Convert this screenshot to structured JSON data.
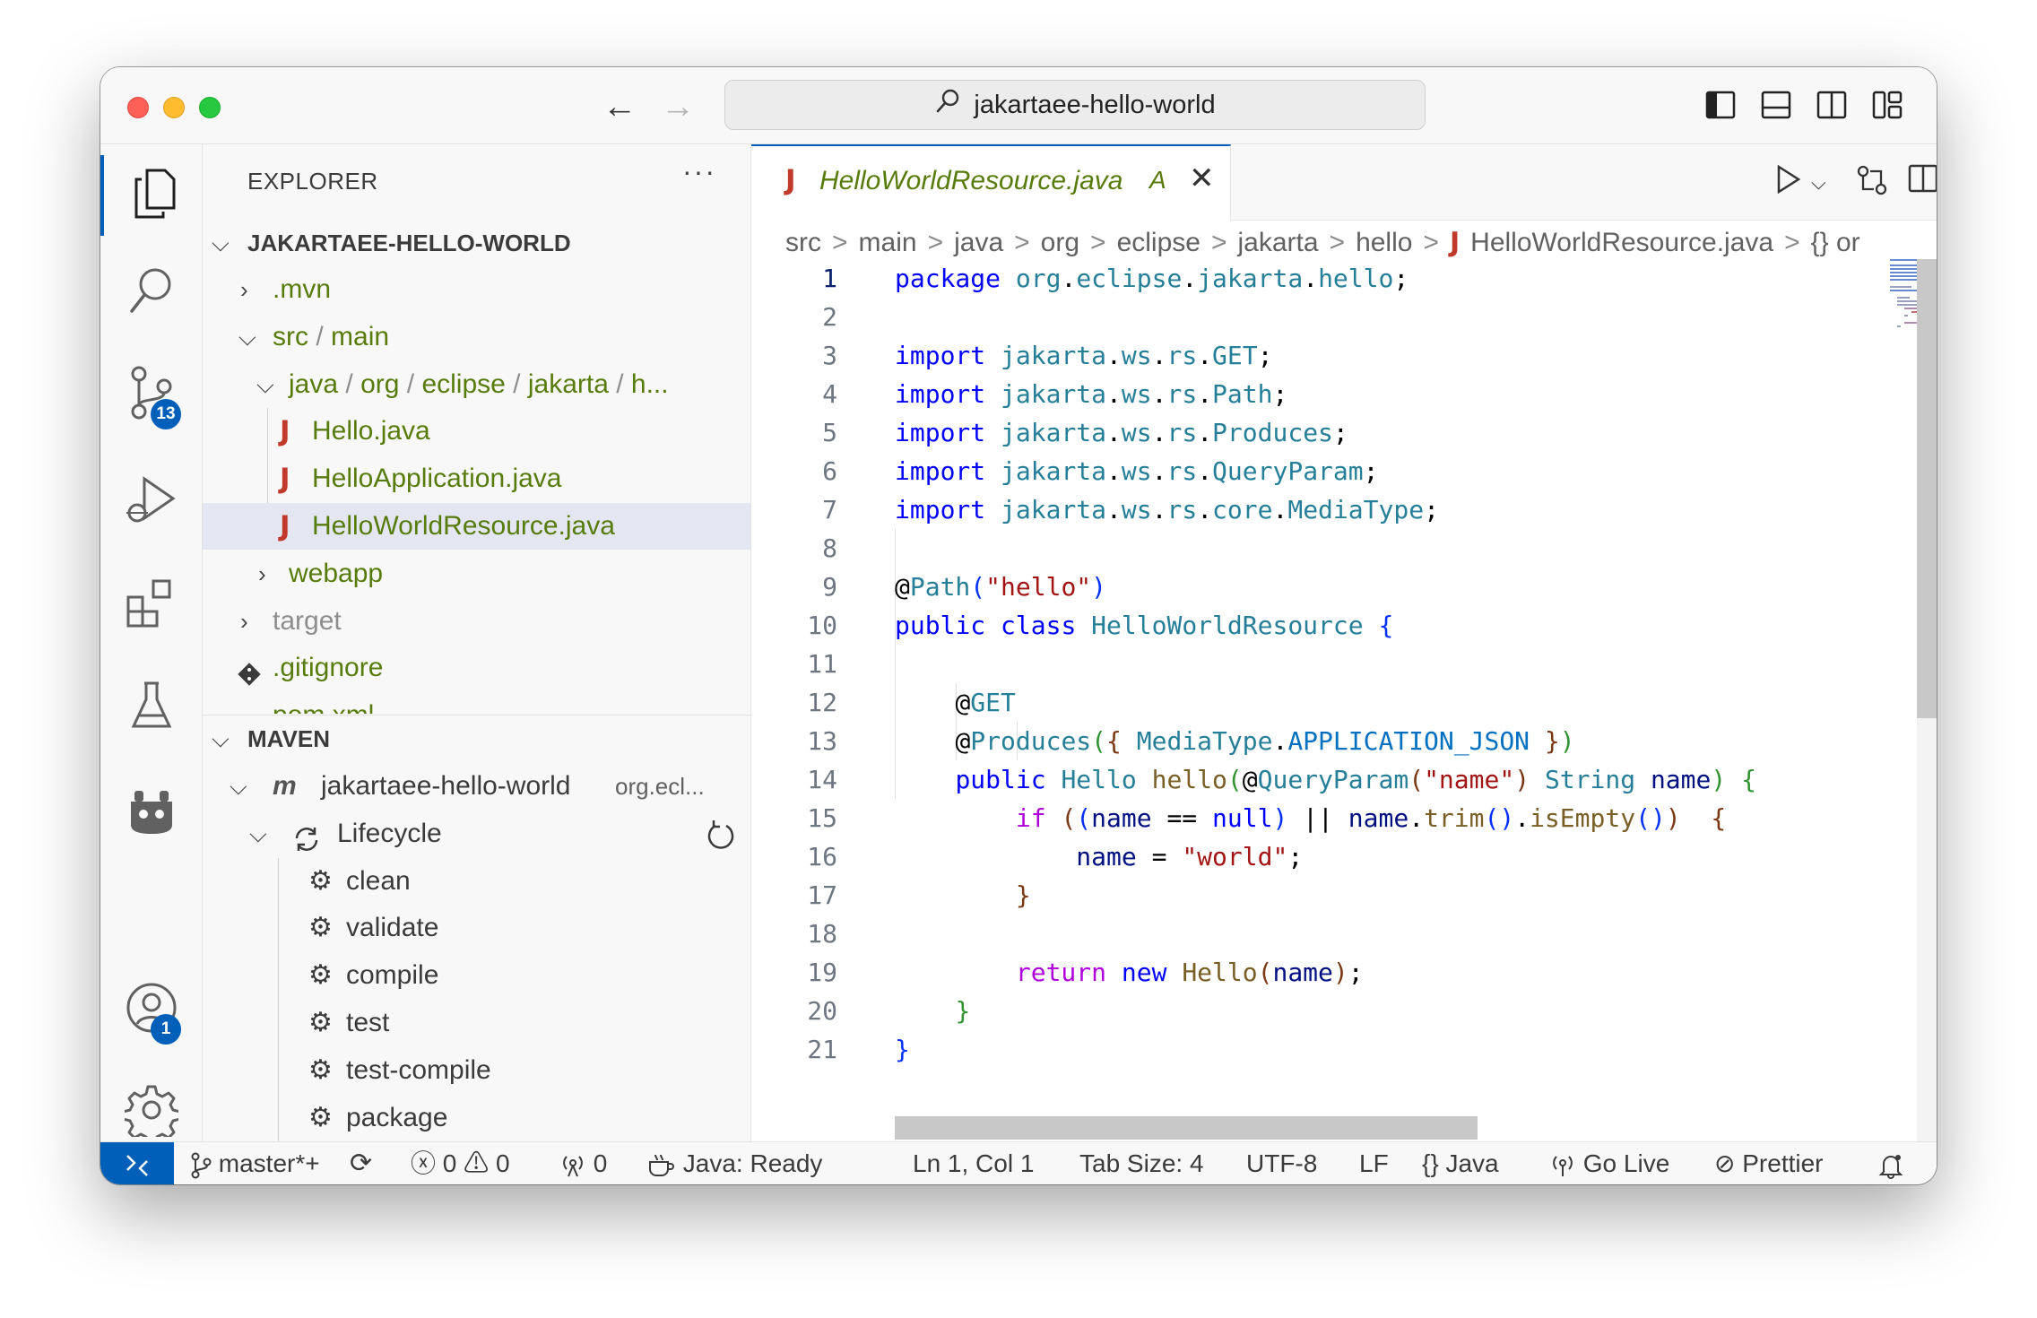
{
  "titlebar": {
    "search_text": "jakartaee-hello-world"
  },
  "activity_bar": {
    "scm_badge": "13",
    "accounts_badge": "1"
  },
  "sidebar": {
    "title": "EXPLORER",
    "more": "···",
    "project": "JAKARTAEE-HELLO-WORLD",
    "tree": [
      {
        "label": ".mvn",
        "status": "dot"
      },
      {
        "label": "src",
        "label2": "main",
        "status": "dot"
      },
      {
        "label": "java",
        "label2": "org",
        "label3": "eclipse",
        "label4": "jakarta",
        "label5": "h...",
        "status": "dot"
      },
      {
        "label": "Hello.java",
        "status": "A"
      },
      {
        "label": "HelloApplication.java",
        "status": "A"
      },
      {
        "label": "HelloWorldResource.java",
        "status": "A"
      },
      {
        "label": "webapp",
        "status": "dot"
      },
      {
        "label": "target"
      },
      {
        "label": ".gitignore",
        "status": "A"
      },
      {
        "label": "pom.xml",
        "status": "A"
      }
    ],
    "maven": {
      "title": "MAVEN",
      "project": "jakartaee-hello-world",
      "project_group": "org.ecl...",
      "lifecycle": "Lifecycle",
      "goals": [
        "clean",
        "validate",
        "compile",
        "test",
        "test-compile",
        "package"
      ]
    }
  },
  "editor": {
    "tab": {
      "label": "HelloWorldResource.java",
      "status": "A"
    },
    "breadcrumb": [
      "src",
      "main",
      "java",
      "org",
      "eclipse",
      "jakarta",
      "hello",
      "HelloWorldResource.java",
      "{} or"
    ],
    "line_numbers": [
      "1",
      "2",
      "3",
      "4",
      "5",
      "6",
      "7",
      "8",
      "9",
      "10",
      "11",
      "12",
      "13",
      "14",
      "15",
      "16",
      "17",
      "18",
      "19",
      "20",
      "21"
    ]
  },
  "statusbar": {
    "branch": "master*+",
    "errors": "0",
    "warnings": "0",
    "ports": "0",
    "java_status": "Java: Ready",
    "cursor": "Ln 1, Col 1",
    "tab_size": "Tab Size: 4",
    "encoding": "UTF-8",
    "eol": "LF",
    "language": "Java",
    "go_live": "Go Live",
    "prettier": "Prettier"
  },
  "colors": {
    "accent": "#005fb8",
    "git_added": "#587c0c",
    "java_icon": "#c0392b"
  }
}
